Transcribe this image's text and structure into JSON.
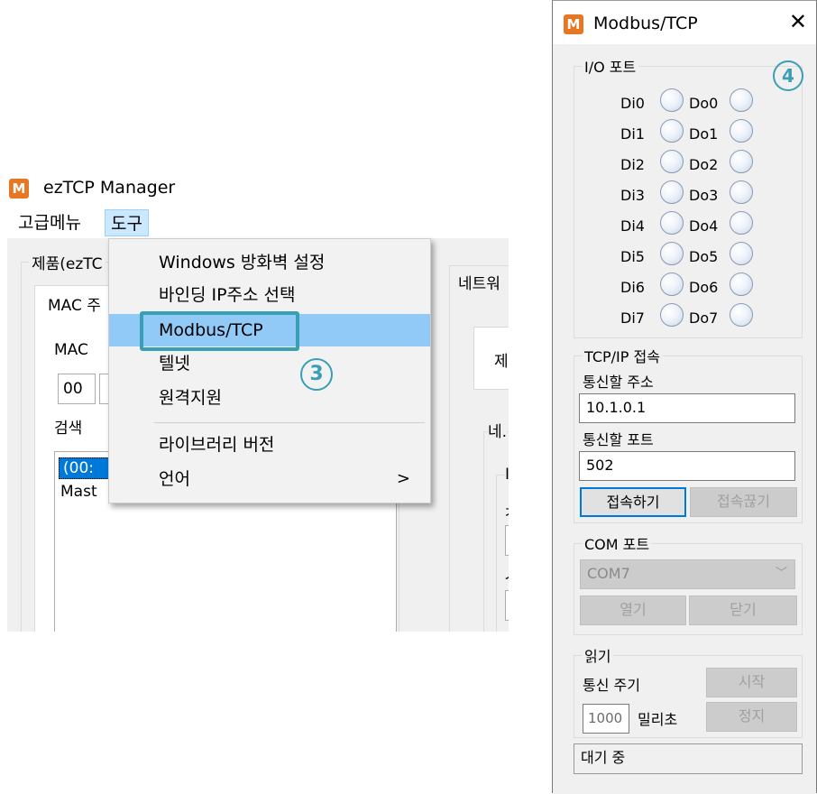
{
  "manager": {
    "title": "ezTCP Manager",
    "app_icon": "M",
    "menu": [
      "고급메뉴",
      "도구"
    ],
    "product_group": "제품(ezTC",
    "mac_tab": "MAC 주",
    "mac_label": "MAC",
    "mac_field": "00",
    "search_label": "검색 ",
    "list_items": [
      "(00:",
      "Mast"
    ],
    "network_tab": "네트워",
    "right_partials": [
      "제",
      "네.",
      "I",
      "ㅈ",
      "ㅅ"
    ]
  },
  "tools_menu": {
    "items": [
      "Windows 방화벽 설정",
      "바인딩 IP주소 선택",
      "Modbus/TCP",
      "텔넷",
      "원격지원",
      "라이브러리 버전",
      "언어"
    ],
    "submenu_arrow": ">",
    "callout": "3"
  },
  "modbus": {
    "title": "Modbus/TCP",
    "app_icon": "M",
    "close_icon": "✕",
    "callout": "4",
    "io_group": "I/O 포트",
    "di": [
      "Di0",
      "Di1",
      "Di2",
      "Di3",
      "Di4",
      "Di5",
      "Di6",
      "Di7"
    ],
    "do": [
      "Do0",
      "Do1",
      "Do2",
      "Do3",
      "Do4",
      "Do5",
      "Do6",
      "Do7"
    ],
    "tcp_group": "TCP/IP 접속",
    "addr_label": "통신할 주소",
    "addr_value": "10.1.0.1",
    "port_label": "통신할 포트",
    "port_value": "502",
    "connect_btn": "접속하기",
    "disconnect_btn": "접속끊기",
    "com_group": "COM 포트",
    "com_value": "COM7",
    "open_btn": "열기",
    "close_btn": "닫기",
    "read_group": "읽기",
    "period_label": "통신 주기",
    "period_value": "1000",
    "ms_label": "밀리초",
    "start_btn": "시작",
    "stop_btn": "정지",
    "status": "대기 중"
  }
}
